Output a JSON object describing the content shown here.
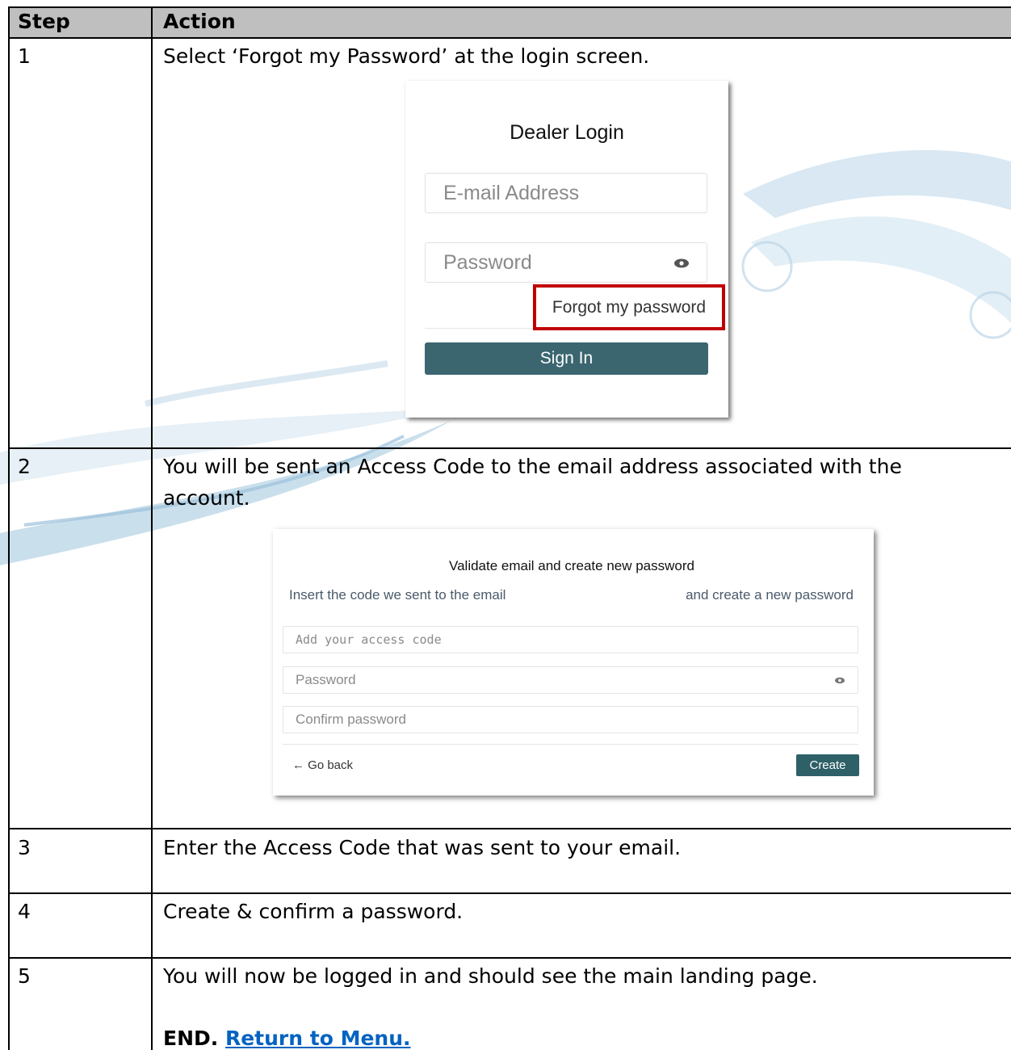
{
  "table": {
    "header": {
      "step": "Step",
      "action": "Action"
    },
    "rows": [
      {
        "step": "1",
        "action": "Select ‘Forgot my Password’ at the login screen."
      },
      {
        "step": "2",
        "action": "You will be sent an Access Code to the email address associated with the account."
      },
      {
        "step": "3",
        "action": "Enter the Access Code that was sent to your email."
      },
      {
        "step": "4",
        "action": "Create & confirm a password."
      },
      {
        "step": "5",
        "action": "You will now be logged in and should see the main landing page."
      }
    ],
    "end_text": "END.",
    "return_link": "Return to Menu."
  },
  "login_screenshot": {
    "title": "Dealer Login",
    "email_placeholder": "E-mail Address",
    "password_placeholder": "Password",
    "forgot_link": "Forgot my password",
    "signin_label": "Sign In",
    "eye_icon": "eye-icon",
    "highlight_color": "#c00000",
    "button_color": "#3b6670"
  },
  "reset_screenshot": {
    "title": "Validate email and create new password",
    "left_hint": "Insert the code we sent to the email",
    "right_hint": "and create a new password",
    "code_placeholder": "Add your access code",
    "password_placeholder": "Password",
    "confirm_placeholder": "Confirm password",
    "back_label": "← Go back",
    "create_label": "Create",
    "eye_icon": "eye-icon",
    "button_color": "#2e6068"
  },
  "colors": {
    "header_bg": "#bfbfbf",
    "link": "#0563c1"
  }
}
